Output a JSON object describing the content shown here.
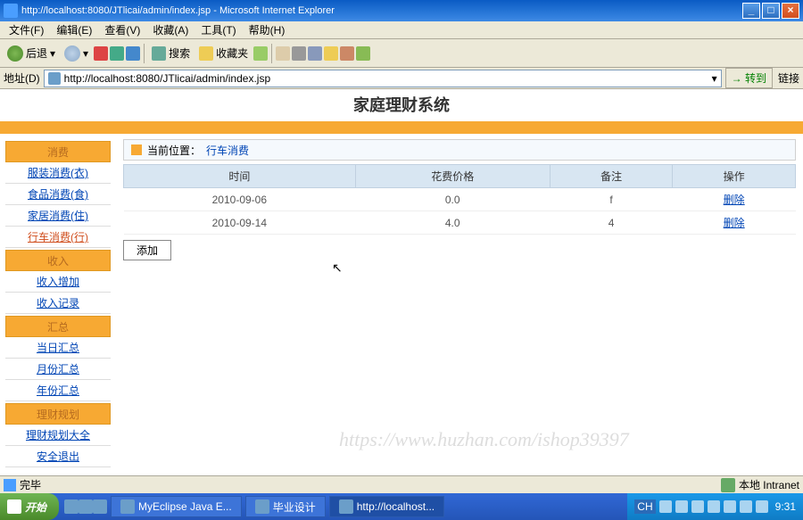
{
  "window": {
    "title": "http://localhost:8080/JTlicai/admin/index.jsp - Microsoft Internet Explorer",
    "minimize": "_",
    "maximize": "□",
    "close": "×"
  },
  "menubar": {
    "file": "文件(F)",
    "edit": "编辑(E)",
    "view": "查看(V)",
    "favorites": "收藏(A)",
    "tools": "工具(T)",
    "help": "帮助(H)"
  },
  "toolbar": {
    "back": "后退",
    "search": "搜索",
    "favorites": "收藏夹"
  },
  "addressbar": {
    "label": "地址(D)",
    "url": "http://localhost:8080/JTlicai/admin/index.jsp",
    "go": "转到",
    "links": "链接"
  },
  "page": {
    "title": "家庭理财系统"
  },
  "sidebar": {
    "sections": [
      {
        "header": "消费",
        "items": [
          {
            "label": "服装消费(衣)"
          },
          {
            "label": "食品消费(食)"
          },
          {
            "label": "家居消费(住)"
          },
          {
            "label": "行车消费(行)",
            "active": true
          }
        ]
      },
      {
        "header": "收入",
        "items": [
          {
            "label": "收入增加"
          },
          {
            "label": "收入记录"
          }
        ]
      },
      {
        "header": "汇总",
        "items": [
          {
            "label": "当日汇总"
          },
          {
            "label": "月份汇总"
          },
          {
            "label": "年份汇总"
          }
        ]
      },
      {
        "header": "理财规划",
        "items": [
          {
            "label": "理财规划大全"
          },
          {
            "label": "安全退出"
          }
        ]
      }
    ]
  },
  "breadcrumb": {
    "label": "当前位置：",
    "value": "行车消费"
  },
  "table": {
    "headers": [
      "时间",
      "花费价格",
      "备注",
      "操作"
    ],
    "rows": [
      {
        "date": "2010-09-06",
        "price": "0.0",
        "note": "f",
        "action": "删除"
      },
      {
        "date": "2010-09-14",
        "price": "4.0",
        "note": "4",
        "action": "删除"
      }
    ]
  },
  "buttons": {
    "add": "添加"
  },
  "watermark": "https://www.huzhan.com/ishop39397",
  "statusbar": {
    "done": "完毕",
    "zone": "本地 Intranet"
  },
  "taskbar": {
    "start": "开始",
    "items": [
      {
        "label": "MyEclipse Java E..."
      },
      {
        "label": "毕业设计"
      },
      {
        "label": "http://localhost..."
      }
    ],
    "lang": "CH",
    "time": "9:31"
  }
}
